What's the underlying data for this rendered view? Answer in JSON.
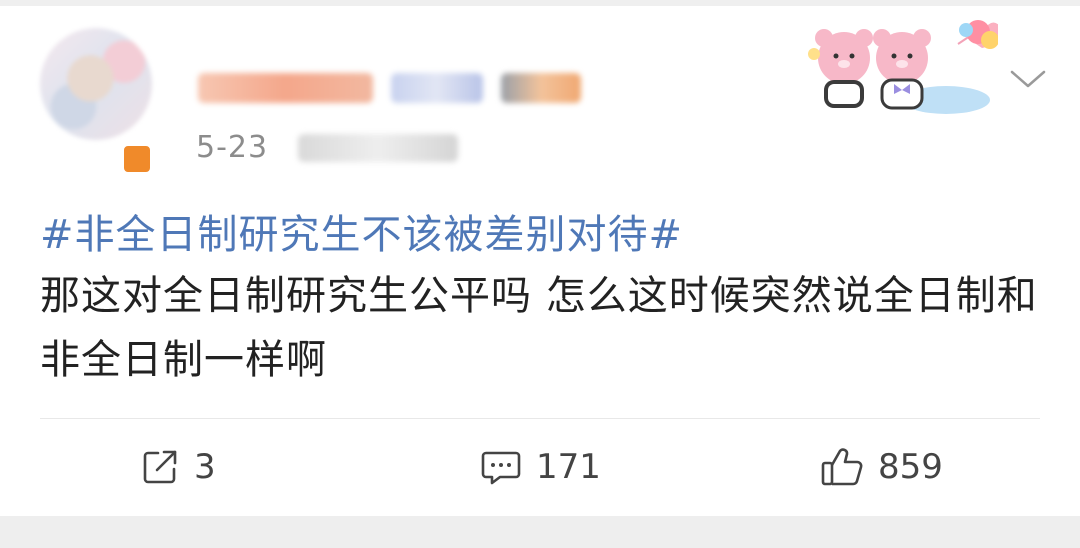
{
  "post": {
    "date": "5-23",
    "hashtag": "#非全日制研究生不该被差别对待#",
    "body": "那这对全日制研究生公平吗 怎么这时候突然说全日制和非全日制一样啊"
  },
  "actions": {
    "repost_count": "3",
    "comment_count": "171",
    "like_count": "859"
  },
  "colors": {
    "hashtag": "#4f78b7",
    "text": "#222222",
    "meta": "#8c8c8c"
  },
  "icons": [
    "share-icon",
    "comment-icon",
    "like-icon",
    "chevron-down-icon",
    "bear-sticker-icon"
  ]
}
